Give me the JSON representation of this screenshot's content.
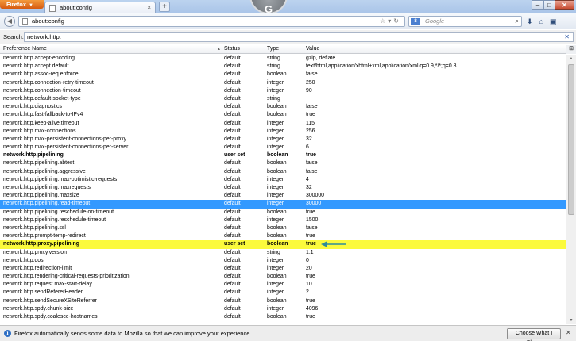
{
  "app": {
    "firefox_button": "Firefox"
  },
  "tab": {
    "title": "about:config"
  },
  "watermark": "G",
  "navbar": {
    "url": "about:config",
    "search_placeholder": "Google",
    "search_engine_badge": "8"
  },
  "filter": {
    "label": "Search:",
    "value": "network.http."
  },
  "columns": {
    "name": "Preference Name",
    "status": "Status",
    "type": "Type",
    "value": "Value"
  },
  "rows": [
    {
      "name": "network.http.accept-encoding",
      "status": "default",
      "type": "string",
      "value": "gzip, deflate"
    },
    {
      "name": "network.http.accept.default",
      "status": "default",
      "type": "string",
      "value": "text/html,application/xhtml+xml,application/xml;q=0.9,*/*;q=0.8"
    },
    {
      "name": "network.http.assoc-req.enforce",
      "status": "default",
      "type": "boolean",
      "value": "false"
    },
    {
      "name": "network.http.connection-retry-timeout",
      "status": "default",
      "type": "integer",
      "value": "250"
    },
    {
      "name": "network.http.connection-timeout",
      "status": "default",
      "type": "integer",
      "value": "90"
    },
    {
      "name": "network.http.default-socket-type",
      "status": "default",
      "type": "string",
      "value": ""
    },
    {
      "name": "network.http.diagnostics",
      "status": "default",
      "type": "boolean",
      "value": "false"
    },
    {
      "name": "network.http.fast-fallback-to-IPv4",
      "status": "default",
      "type": "boolean",
      "value": "true"
    },
    {
      "name": "network.http.keep-alive.timeout",
      "status": "default",
      "type": "integer",
      "value": "115"
    },
    {
      "name": "network.http.max-connections",
      "status": "default",
      "type": "integer",
      "value": "256"
    },
    {
      "name": "network.http.max-persistent-connections-per-proxy",
      "status": "default",
      "type": "integer",
      "value": "32"
    },
    {
      "name": "network.http.max-persistent-connections-per-server",
      "status": "default",
      "type": "integer",
      "value": "6"
    },
    {
      "name": "network.http.pipelining",
      "status": "user set",
      "type": "boolean",
      "value": "true",
      "style": "bold"
    },
    {
      "name": "network.http.pipelining.abtest",
      "status": "default",
      "type": "boolean",
      "value": "false"
    },
    {
      "name": "network.http.pipelining.aggressive",
      "status": "default",
      "type": "boolean",
      "value": "false"
    },
    {
      "name": "network.http.pipelining.max-optimistic-requests",
      "status": "default",
      "type": "integer",
      "value": "4"
    },
    {
      "name": "network.http.pipelining.maxrequests",
      "status": "default",
      "type": "integer",
      "value": "32"
    },
    {
      "name": "network.http.pipelining.maxsize",
      "status": "default",
      "type": "integer",
      "value": "300000"
    },
    {
      "name": "network.http.pipelining.read-timeout",
      "status": "default",
      "type": "integer",
      "value": "30000",
      "style": "selected"
    },
    {
      "name": "network.http.pipelining.reschedule-on-timeout",
      "status": "default",
      "type": "boolean",
      "value": "true"
    },
    {
      "name": "network.http.pipelining.reschedule-timeout",
      "status": "default",
      "type": "integer",
      "value": "1500"
    },
    {
      "name": "network.http.pipelining.ssl",
      "status": "default",
      "type": "boolean",
      "value": "false"
    },
    {
      "name": "network.http.prompt-temp-redirect",
      "status": "default",
      "type": "boolean",
      "value": "true"
    },
    {
      "name": "network.http.proxy.pipelining",
      "status": "user set",
      "type": "boolean",
      "value": "true",
      "style": "highlight"
    },
    {
      "name": "network.http.proxy.version",
      "status": "default",
      "type": "string",
      "value": "1.1"
    },
    {
      "name": "network.http.qos",
      "status": "default",
      "type": "integer",
      "value": "0"
    },
    {
      "name": "network.http.redirection-limit",
      "status": "default",
      "type": "integer",
      "value": "20"
    },
    {
      "name": "network.http.rendering-critical-requests-prioritization",
      "status": "default",
      "type": "boolean",
      "value": "true"
    },
    {
      "name": "network.http.request.max-start-delay",
      "status": "default",
      "type": "integer",
      "value": "10"
    },
    {
      "name": "network.http.sendRefererHeader",
      "status": "default",
      "type": "integer",
      "value": "2"
    },
    {
      "name": "network.http.sendSecureXSiteReferrer",
      "status": "default",
      "type": "boolean",
      "value": "true"
    },
    {
      "name": "network.http.spdy.chunk-size",
      "status": "default",
      "type": "integer",
      "value": "4096"
    },
    {
      "name": "network.http.spdy.coalesce-hostnames",
      "status": "default",
      "type": "boolean",
      "value": "true"
    }
  ],
  "notification": {
    "text": "Firefox automatically sends some data to Mozilla so that we can improve your experience.",
    "button": "Choose What I Share"
  },
  "colors": {
    "selected": "#3399ff",
    "highlight": "#fbfa3c",
    "arrow": "#2e8b9a"
  }
}
